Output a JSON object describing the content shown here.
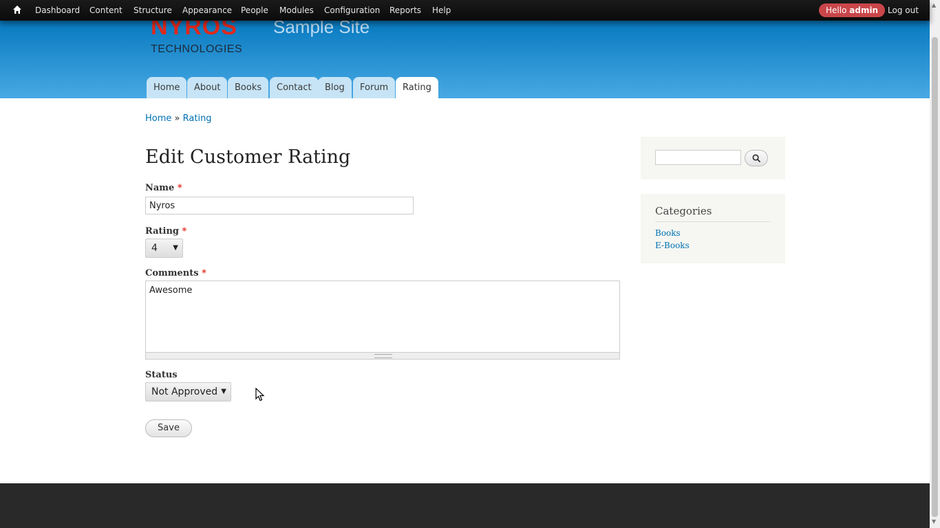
{
  "toolbar": {
    "home_icon": "home-icon",
    "items": [
      "Dashboard",
      "Content",
      "Structure",
      "Appearance",
      "People",
      "Modules",
      "Configuration",
      "Reports",
      "Help"
    ],
    "hello_prefix": "Hello",
    "hello_user": "admin",
    "logout": "Log out"
  },
  "header": {
    "logo_top": "NYROS",
    "logo_bottom": "TECHNOLOGIES",
    "site_name": "Sample Site",
    "tabs": [
      "Home",
      "About",
      "Books",
      "Contact",
      "Blog",
      "Forum",
      "Rating"
    ],
    "active_tab": "Rating"
  },
  "breadcrumb": {
    "home": "Home",
    "separator": "»",
    "current": "Rating"
  },
  "form": {
    "title": "Edit Customer Rating",
    "required_marker": "*",
    "name_label": "Name",
    "name_value": "Nyros",
    "rating_label": "Rating",
    "rating_value": "4",
    "comments_label": "Comments",
    "comments_value": "Awesome",
    "status_label": "Status",
    "status_value": "Not Approved",
    "save_label": "Save"
  },
  "sidebar": {
    "search_icon": "search-icon",
    "categories_title": "Categories",
    "categories": [
      "Books",
      "E-Books"
    ]
  },
  "colors": {
    "header_top": "#0779bf",
    "header_bottom": "#48a9e4",
    "link": "#0071b3",
    "required": "#e0281c",
    "hello_badge": "#c9464a",
    "footer": "#292929"
  }
}
